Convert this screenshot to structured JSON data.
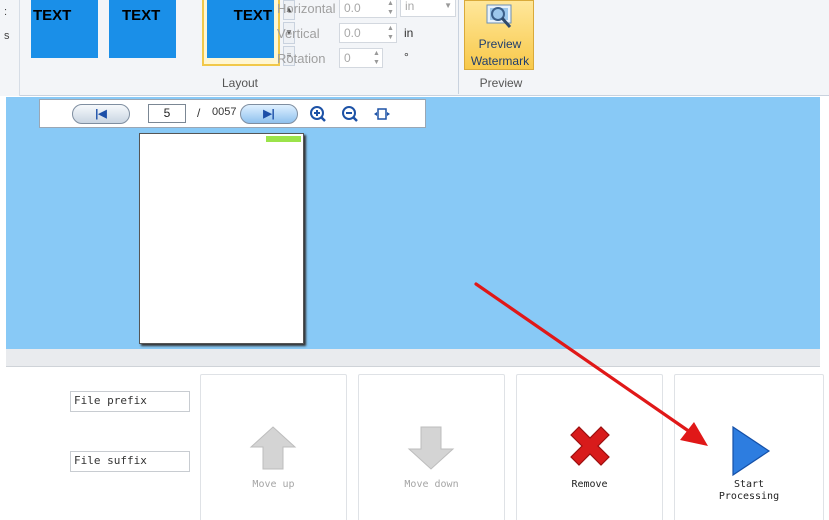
{
  "left_edge": {
    "glyphs": [
      ":",
      "s"
    ]
  },
  "layout_group": {
    "caption": "Layout",
    "thumbnails": [
      {
        "label": "TEXT",
        "align": "left",
        "selected": false
      },
      {
        "label": "TEXT",
        "align": "center",
        "selected": false
      },
      {
        "label": "TEXT",
        "align": "right",
        "selected": true
      }
    ],
    "horizontal": {
      "label": "Horizontal",
      "value": "0.0",
      "unit": "in"
    },
    "vertical": {
      "label": "Vertical",
      "value": "0.0",
      "unit": "in"
    },
    "rotation": {
      "label": "Rotation",
      "value": "0",
      "unit": "°"
    }
  },
  "preview_group": {
    "caption": "Preview",
    "button_line1": "Preview",
    "button_line2": "Watermark"
  },
  "viewer": {
    "current_page": "5",
    "separator": "/",
    "total_pages": "0057",
    "background_color": "#88c9f6"
  },
  "bottom": {
    "file_prefix": "File prefix",
    "file_suffix": "File suffix",
    "actions": {
      "move_up": "Move up",
      "move_down": "Move down",
      "remove": "Remove",
      "start_line1": "Start",
      "start_line2": "Processing"
    }
  },
  "icons": [
    "first-page-icon",
    "next-page-icon",
    "zoom-in-icon",
    "zoom-out-icon",
    "fit-page-icon",
    "magnifier-icon",
    "arrow-up-icon",
    "arrow-down-icon",
    "red-x-icon",
    "play-icon"
  ],
  "colors": {
    "accent_blue": "#1a8fe8",
    "annotation_red": "#e01818",
    "preview_gold": "#f8c94b"
  }
}
